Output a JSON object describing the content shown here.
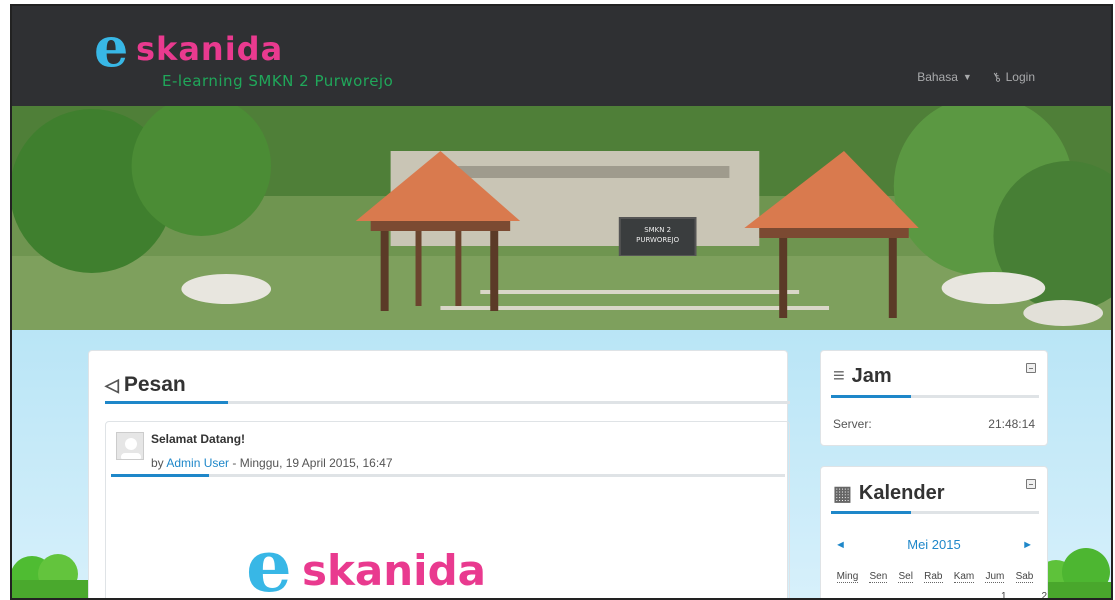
{
  "brand": {
    "logo_letter": "e",
    "logo_word": "skanida",
    "subtitle": "E-learning SMKN 2 Purworejo"
  },
  "nav": {
    "language_label": "Bahasa",
    "login_label": "Login"
  },
  "hero": {
    "sign_line1": "SMKN 2",
    "sign_line2": "PURWOREJO",
    "slides": 3,
    "active_slide": 1
  },
  "messages": {
    "title": "Pesan",
    "post": {
      "title": "Selamat Datang!",
      "by": "by",
      "author": "Admin User",
      "date": "- Minggu, 19 April 2015, 16:47",
      "image_letter": "e",
      "image_word": "skanida"
    }
  },
  "clock": {
    "title": "Jam",
    "server_label": "Server:",
    "server_time": "21:48:14"
  },
  "calendar": {
    "title": "Kalender",
    "month": "Mei 2015",
    "prev": "◄",
    "next": "►",
    "days": [
      "Ming",
      "Sen",
      "Sel",
      "Rab",
      "Kam",
      "Jum",
      "Sab"
    ],
    "visible_dates": [
      "1",
      "2"
    ]
  },
  "colors": {
    "navbar": "#2f3033",
    "accent": "#1e87c9",
    "logo_blue": "#38b7e6",
    "logo_pink": "#e93a8f",
    "logo_green": "#20a75a"
  }
}
